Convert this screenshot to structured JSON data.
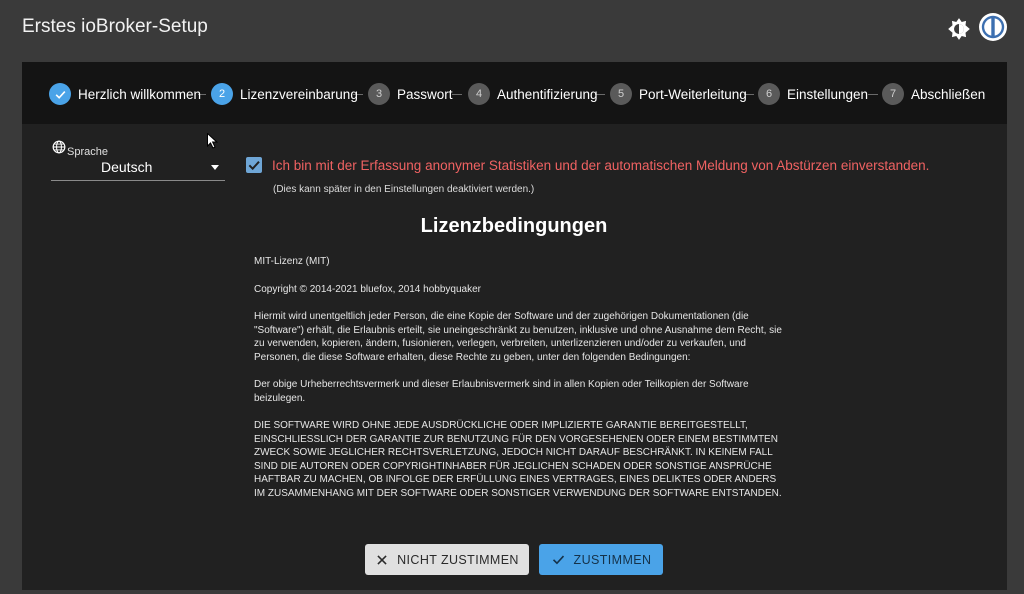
{
  "app": {
    "title": "Erstes ioBroker-Setup"
  },
  "stepper": {
    "steps": [
      {
        "number": "",
        "label": "Herzlich willkommen",
        "state": "done"
      },
      {
        "number": "2",
        "label": "Lizenzvereinbarung",
        "state": "active"
      },
      {
        "number": "3",
        "label": "Passwort",
        "state": "todo"
      },
      {
        "number": "4",
        "label": "Authentifizierung",
        "state": "todo"
      },
      {
        "number": "5",
        "label": "Port-Weiterleitung",
        "state": "todo"
      },
      {
        "number": "6",
        "label": "Einstellungen",
        "state": "todo"
      },
      {
        "number": "7",
        "label": "Abschließen",
        "state": "todo"
      }
    ]
  },
  "language": {
    "label": "Sprache",
    "value": "Deutsch"
  },
  "consent": {
    "checked": true,
    "text": "Ich bin mit der Erfassung anonymer Statistiken und der automatischen Meldung von Abstürzen einverstanden.",
    "hint": "(Dies kann später in den Einstellungen deaktiviert werden.)"
  },
  "license": {
    "title": "Lizenzbedingungen",
    "paragraphs": [
      "MIT-Lizenz (MIT)",
      "Copyright © 2014-2021 bluefox, 2014 hobbyquaker",
      "Hiermit wird unentgeltlich jeder Person, die eine Kopie der Software und der zugehörigen Dokumentationen (die \"Software\") erhält, die Erlaubnis erteilt, sie uneingeschränkt zu benutzen, inklusive und ohne Ausnahme dem Recht, sie zu verwenden, kopieren, ändern, fusionieren, verlegen, verbreiten, unterlizenzieren und/oder zu verkaufen, und Personen, die diese Software erhalten, diese Rechte zu geben, unter den folgenden Bedingungen:",
      "Der obige Urheberrechtsvermerk und dieser Erlaubnisvermerk sind in allen Kopien oder Teilkopien der Software beizulegen.",
      "DIE SOFTWARE WIRD OHNE JEDE AUSDRÜCKLICHE ODER IMPLIZIERTE GARANTIE BEREITGESTELLT, EINSCHLIESSLICH DER GARANTIE ZUR BENUTZUNG FÜR DEN VORGESEHENEN ODER EINEM BESTIMMTEN ZWECK SOWIE JEGLICHER RECHTSVERLETZUNG, JEDOCH NICHT DARAUF BESCHRÄNKT. IN KEINEM FALL SIND DIE AUTOREN ODER COPYRIGHTINHABER FÜR JEGLICHEN SCHADEN ODER SONSTIGE ANSPRÜCHE HAFTBAR ZU MACHEN, OB INFOLGE DER ERFÜLLUNG EINES VERTRAGES, EINES DELIKTES ODER ANDERS IM ZUSAMMENHANG MIT DER SOFTWARE ODER SONSTIGER VERWENDUNG DER SOFTWARE ENTSTANDEN."
    ]
  },
  "actions": {
    "decline_label": "NICHT ZUSTIMMEN",
    "accept_label": "ZUSTIMMEN"
  },
  "icons": {
    "theme": "brightness-icon",
    "logo": "iobroker-logo-icon",
    "language": "globe-icon",
    "decline": "close-icon",
    "accept": "check-icon"
  },
  "colors": {
    "accent": "#4aa3e8",
    "consent_text": "#f06262",
    "panel": "#212121",
    "stepper": "#141414",
    "background": "#3a3a3a"
  }
}
